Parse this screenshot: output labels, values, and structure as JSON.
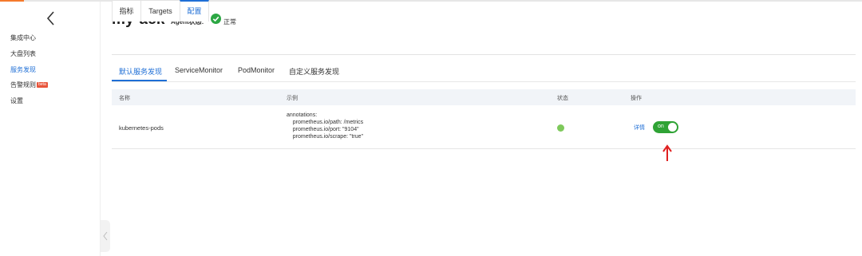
{
  "colors": {
    "accent": "#1f6fd6",
    "success": "#2ca744",
    "toggle_on": "#2fa335",
    "status_dot": "#7ec95b",
    "beta": "#e8553b",
    "arrow": "#e02020"
  },
  "sidebar": {
    "back_icon": "chevron-left-icon",
    "items": [
      {
        "label": "集成中心"
      },
      {
        "label": "大盘列表"
      },
      {
        "label": "服务发现",
        "active": true
      },
      {
        "label": "告警规则",
        "badge": "beta"
      },
      {
        "label": "设置"
      }
    ]
  },
  "header": {
    "title": "my-ack",
    "agent_label": "Agent状态:",
    "agent_status": "正常",
    "agent_icon": "check-circle-icon"
  },
  "tabs": [
    {
      "label": "指标"
    },
    {
      "label": "Targets"
    },
    {
      "label": "配置",
      "active": true
    }
  ],
  "subtabs": [
    {
      "label": "默认服务发现",
      "active": true
    },
    {
      "label": "ServiceMonitor"
    },
    {
      "label": "PodMonitor"
    },
    {
      "label": "自定义服务发现"
    }
  ],
  "table": {
    "columns": [
      "名称",
      "示例",
      "状态",
      "操作"
    ],
    "rows": [
      {
        "name": "kubernetes-pods",
        "example": "annotations:\n    prometheus.io/path: /metrics\n    prometheus.io/port: \"9104\"\n    prometheus.io/scrape: \"true\"",
        "status": "running",
        "action_label": "详情",
        "toggle_label": "on",
        "toggle_on": true
      }
    ]
  },
  "annotation_icon": "red-up-arrow-icon"
}
